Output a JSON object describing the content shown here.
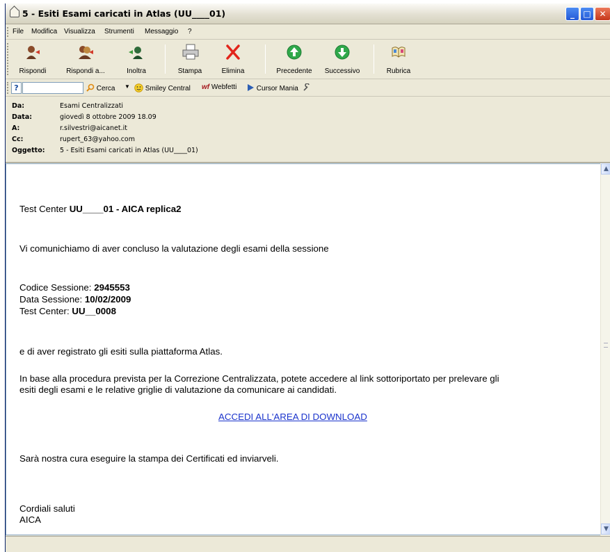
{
  "window": {
    "title": "5 - Esiti Esami caricati in Atlas (UU____01)",
    "minimize_glyph": "_",
    "maximize_glyph": "□",
    "close_glyph": "✕"
  },
  "menubar": {
    "items": [
      "File",
      "Modifica",
      "Visualizza",
      "Strumenti",
      "Messaggio",
      "?"
    ]
  },
  "toolbar": {
    "buttons": [
      {
        "label": "Rispondi",
        "icon": "reply-icon"
      },
      {
        "label": "Rispondi a...",
        "icon": "reply-all-icon"
      },
      {
        "label": "Inoltra",
        "icon": "forward-icon"
      },
      {
        "label": "Stampa",
        "icon": "printer-icon"
      },
      {
        "label": "Elimina",
        "icon": "delete-icon"
      },
      {
        "label": "Precedente",
        "icon": "arrow-up-icon"
      },
      {
        "label": "Successivo",
        "icon": "arrow-down-icon"
      },
      {
        "label": "Rubrica",
        "icon": "address-book-icon"
      }
    ]
  },
  "searchbar": {
    "input_value": "",
    "search_label": "Cerca",
    "smiley_label": "Smiley Central",
    "webfetti_label": "Webfetti",
    "cursor_label": "Cursor Mania"
  },
  "header": {
    "from_label": "Da:",
    "from": "Esami Centralizzati",
    "date_label": "Data:",
    "date": "giovedì 8 ottobre 2009 18.09",
    "to_label": "A:",
    "to": "r.silvestri@aicanet.it",
    "cc_label": "Cc:",
    "cc": "rupert_63@yahoo.com",
    "subject_label": "Oggetto:",
    "subject": "5 - Esiti Esami caricati in Atlas (UU____01)"
  },
  "message": {
    "tc_prefix": "Test Center ",
    "tc_name": "UU____01 - AICA replica2",
    "intro": "Vi comunichiamo di aver concluso la valutazione degli esami della sessione",
    "codice_label": "Codice Sessione: ",
    "codice_value": "2945553",
    "data_label": "Data Sessione: ",
    "data_value": "10/02/2009",
    "tc2_label": "Test Center: ",
    "tc2_value": "UU__0008",
    "registered": "e di aver registrato gli esiti sulla piattaforma Atlas.",
    "procedure_line1": "In base alla procedura prevista per la Correzione Centralizzata, potete accedere al link sottoriportato per prelevare gli",
    "procedure_line2": "esiti degli esami e le relative griglie di valutazione da comunicare ai candidati.",
    "link": "ACCEDI ALL'AREA DI DOWNLOAD",
    "certificati": "Sarà nostra cura eseguire la stampa dei Certificati ed inviarveli.",
    "closing": "Cordiali saluti",
    "signature": "AICA"
  },
  "colors": {
    "link": "#1a33cc",
    "chrome": "#ece9d8",
    "titlebar_close": "#c5371a"
  }
}
